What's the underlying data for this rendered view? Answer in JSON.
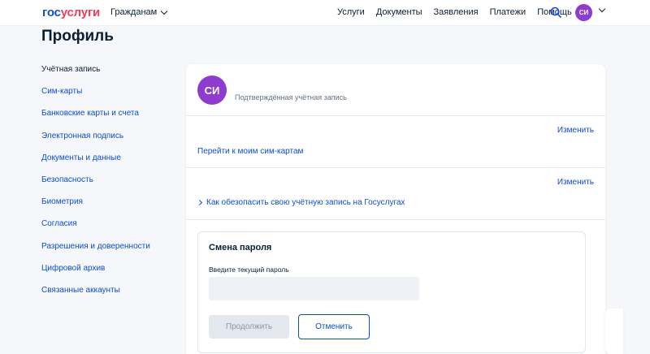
{
  "header": {
    "logo_part1": "гос",
    "logo_part2": "услуги",
    "audience": "Гражданам",
    "nav": [
      "Услуги",
      "Документы",
      "Заявления",
      "Платежи",
      "Помощь"
    ],
    "user_initials": "СИ"
  },
  "page": {
    "title": "Профиль"
  },
  "sidebar": {
    "items": [
      {
        "label": "Учётная запись",
        "active": true
      },
      {
        "label": "Сим-карты"
      },
      {
        "label": "Банковские карты и счета"
      },
      {
        "label": "Электронная подпись"
      },
      {
        "label": "Документы и данные"
      },
      {
        "label": "Безопасность"
      },
      {
        "label": "Биометрия"
      },
      {
        "label": "Согласия"
      },
      {
        "label": "Разрешения и доверенности"
      },
      {
        "label": "Цифровой архив"
      },
      {
        "label": "Связанные аккаунты"
      }
    ]
  },
  "account": {
    "initials": "СИ",
    "status": "Подтверждённая учётная запись",
    "edit_label_1": "Изменить",
    "sim_link": "Перейти к моим сим-картам",
    "edit_label_2": "Изменить",
    "secure_link": "Как обезопасить свою учётную запись на Госуслугах"
  },
  "password": {
    "title": "Смена пароля",
    "current_label": "Введите текущий пароль",
    "current_value": "",
    "continue_label": "Продолжить",
    "cancel_label": "Отменить"
  },
  "colors": {
    "brand_blue": "#0d4cd3",
    "brand_red": "#ee3f58",
    "avatar_purple": "#8e3bd0"
  }
}
